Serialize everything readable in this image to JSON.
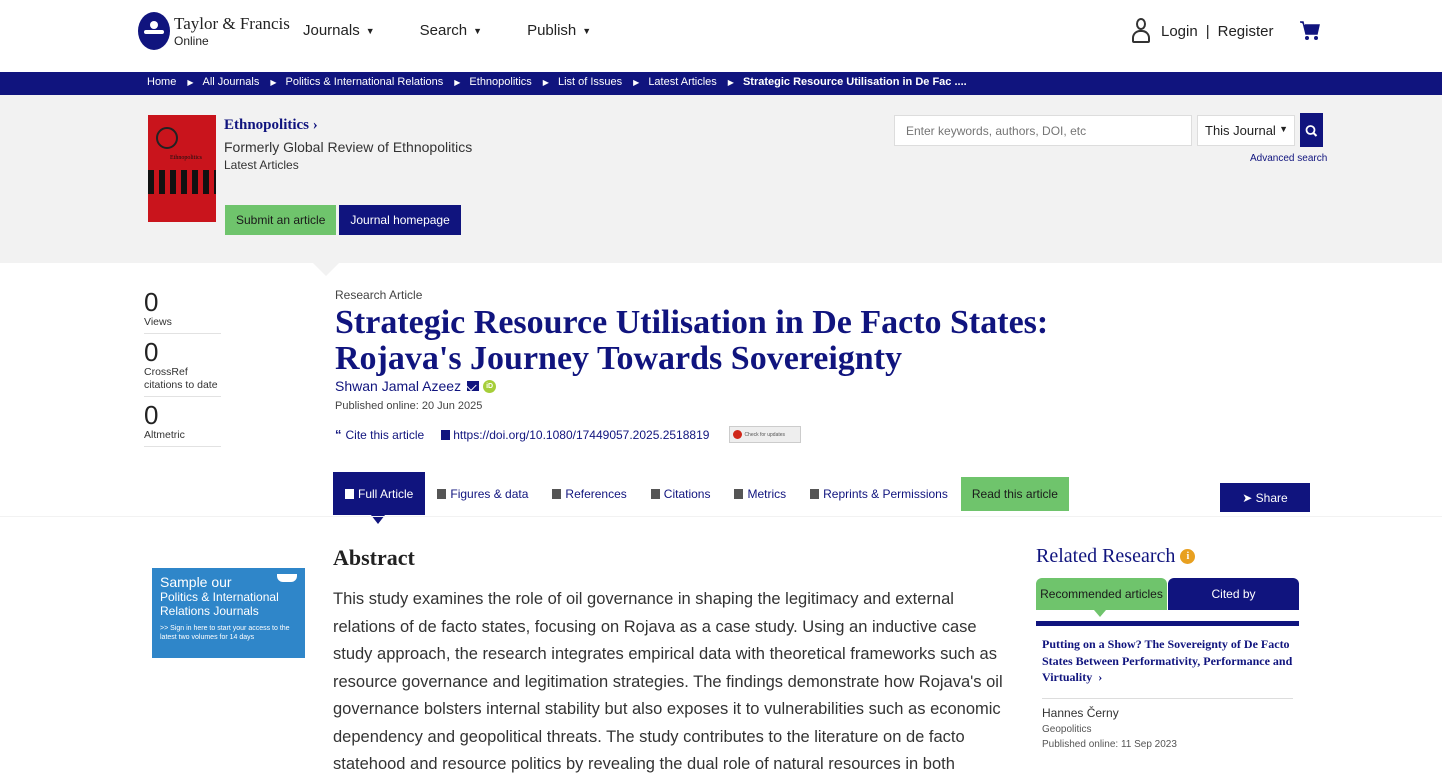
{
  "header": {
    "logo_line1": "Taylor & Francis",
    "logo_line2": "Online",
    "nav": [
      {
        "label": "Journals"
      },
      {
        "label": "Search"
      },
      {
        "label": "Publish"
      }
    ],
    "login": "Login",
    "separator": "|",
    "register": "Register"
  },
  "breadcrumb": [
    "Home",
    "All Journals",
    "Politics & International Relations",
    "Ethnopolitics",
    "List of Issues",
    "Latest Articles",
    "Strategic Resource Utilisation in De Fac ...."
  ],
  "journal": {
    "name": "Ethnopolitics",
    "name_chevron": "›",
    "formerly": "Formerly Global Review of Ethnopolitics",
    "latest": "Latest Articles",
    "cover_title": "Ethnopolitics",
    "submit_button": "Submit an article",
    "homepage_button": "Journal homepage"
  },
  "search": {
    "placeholder": "Enter keywords, authors, DOI, etc",
    "scope": "This Journal",
    "advanced": "Advanced search"
  },
  "metrics": [
    {
      "value": "0",
      "label": "Views"
    },
    {
      "value": "0",
      "label": "CrossRef citations to date"
    },
    {
      "value": "0",
      "label": "Altmetric"
    }
  ],
  "article": {
    "type": "Research Article",
    "title": "Strategic Resource Utilisation in De Facto States: Rojava's Journey Towards Sovereignty",
    "author": "Shwan Jamal Azeez",
    "published": "Published online: 20 Jun 2025",
    "cite_label": "Cite this article",
    "doi": "https://doi.org/10.1080/17449057.2025.2518819",
    "check_updates": "Check for updates"
  },
  "tabs": [
    {
      "label": "Full Article",
      "active": true
    },
    {
      "label": "Figures & data"
    },
    {
      "label": "References"
    },
    {
      "label": "Citations"
    },
    {
      "label": "Metrics"
    },
    {
      "label": "Reprints & Permissions"
    }
  ],
  "read_button": "Read this article",
  "share_button": "Share",
  "ad": {
    "line1": "Sample our",
    "line2": "Politics & International Relations Journals",
    "line3": ">> Sign in here to start your access to the latest two volumes for 14 days"
  },
  "abstract": {
    "heading": "Abstract",
    "text": "This study examines the role of oil governance in shaping the legitimacy and external relations of de facto states, focusing on Rojava as a case study. Using an inductive case study approach, the research integrates empirical data with theoretical frameworks such as resource governance and legitimation strategies. The findings demonstrate how Rojava's oil governance bolsters internal stability but also exposes it to vulnerabilities such as economic dependency and geopolitical threats. The study contributes to the literature on de facto statehood and resource politics by revealing the dual role of natural resources in both empowering and undermining de facto states."
  },
  "related": {
    "heading": "Related Research",
    "tab_recommended": "Recommended articles",
    "tab_cited": "Cited by",
    "item": {
      "title": "Putting on a Show? The Sovereignty of De Facto States Between Performativity, Performance and Virtuality",
      "author": "Hannes Černy",
      "journal": "Geopolitics",
      "published": "Published online: 11 Sep 2023"
    }
  },
  "colors": {
    "brand_navy": "#10147e",
    "accent_green": "#6fc46c",
    "banner_grey": "#f2f2f2"
  }
}
